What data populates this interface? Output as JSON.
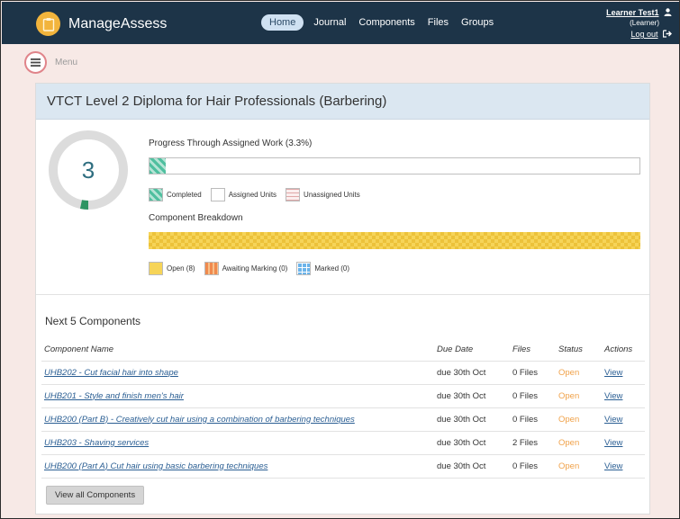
{
  "header": {
    "brand": "ManageAssess",
    "nav": [
      "Home",
      "Journal",
      "Components",
      "Files",
      "Groups"
    ],
    "user_name": "Learner Test1",
    "user_role": "(Learner)",
    "logout": "Log out"
  },
  "menu": {
    "label": "Menu"
  },
  "qualification": {
    "title": "VTCT Level 2 Diploma for Hair Professionals (Barbering)",
    "donut_value": "3",
    "progress_fraction": 0.033,
    "progress_title": "Progress Through Assigned Work (3.3%)",
    "progress_legend": [
      "Completed",
      "Assigned Units",
      "Unassigned Units"
    ],
    "breakdown_title": "Component Breakdown",
    "breakdown_legend": [
      "Open (8)",
      "Awaiting Marking (0)",
      "Marked (0)"
    ]
  },
  "components": {
    "title": "Next 5 Components",
    "headers": [
      "Component Name",
      "Due Date",
      "Files",
      "Status",
      "Actions"
    ],
    "rows": [
      {
        "name": "UHB202 - Cut facial hair into shape",
        "due": "due 30th Oct",
        "files": "0 Files",
        "status": "Open",
        "action": "View"
      },
      {
        "name": "UHB201 - Style and finish men's hair",
        "due": "due 30th Oct",
        "files": "0 Files",
        "status": "Open",
        "action": "View"
      },
      {
        "name": "UHB200 (Part B) - Creatively cut hair using a combination of barbering techniques",
        "due": "due 30th Oct",
        "files": "0 Files",
        "status": "Open",
        "action": "View"
      },
      {
        "name": "UHB203 - Shaving services",
        "due": "due 30th Oct",
        "files": "2 Files",
        "status": "Open",
        "action": "View"
      },
      {
        "name": "UHB200 (Part A) Cut hair using basic barbering techniques",
        "due": "due 30th Oct",
        "files": "0 Files",
        "status": "Open",
        "action": "View"
      }
    ],
    "view_all": "View all Components"
  },
  "colors": {
    "topbar": "#1d3448",
    "accent": "#f2b43c",
    "open_status": "#f0a24a",
    "link": "#2a5e93"
  },
  "icons": {
    "logo": "clipboard-icon",
    "user": "user-icon",
    "logout": "sign-out-icon",
    "menu": "hamburger-icon"
  }
}
